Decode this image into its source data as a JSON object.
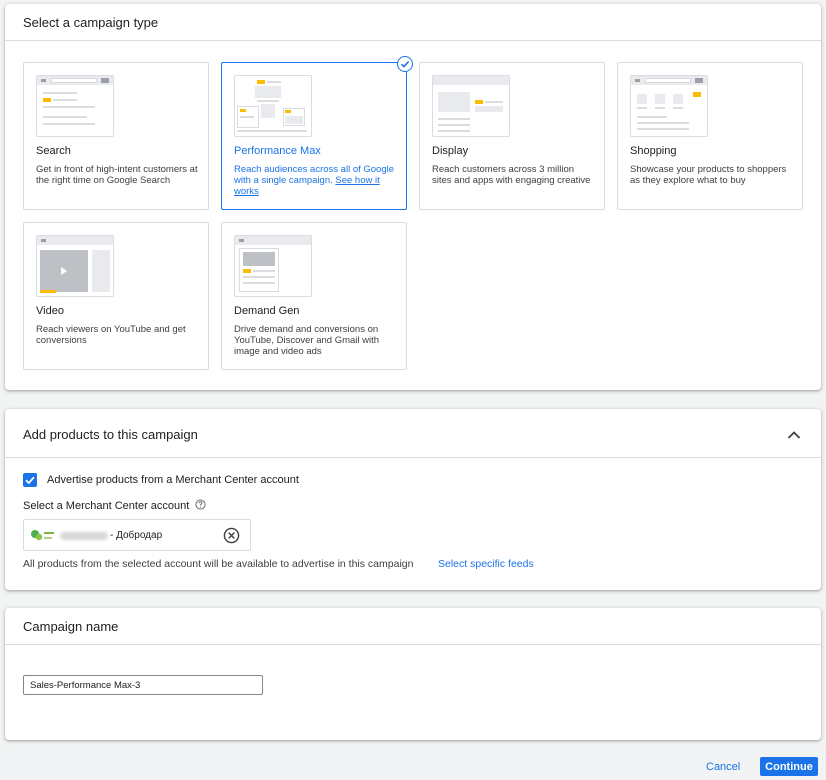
{
  "campaign_type": {
    "header": "Select a campaign type",
    "cards": [
      {
        "title": "Search",
        "description": "Get in front of high-intent customers at the right time on Google Search"
      },
      {
        "title": "Performance Max",
        "description": "Reach audiences across all of Google with a single campaign.",
        "link": "See how it works",
        "selected": true
      },
      {
        "title": "Display",
        "description": "Reach customers across 3 million sites and apps with engaging creative"
      },
      {
        "title": "Shopping",
        "description": "Showcase your products to shoppers as they explore what to buy"
      },
      {
        "title": "Video",
        "description": "Reach viewers on YouTube and get conversions"
      },
      {
        "title": "Demand Gen",
        "description": "Drive demand and conversions on YouTube, Discover and Gmail with image and video ads"
      }
    ]
  },
  "products": {
    "header": "Add products to this campaign",
    "checkbox_label": "Advertise products from a Merchant Center account",
    "checked": true,
    "select_label": "Select a Merchant Center account",
    "account_name": "- Добродар",
    "note": "All products from the selected account will be available to advertise in this campaign",
    "feeds_link": "Select specific feeds"
  },
  "campaign_name": {
    "header": "Campaign name",
    "value": "Sales-Performance Max-3"
  },
  "footer": {
    "cancel": "Cancel",
    "continue": "Continue"
  },
  "colors": {
    "accent": "#1a73e8",
    "yellow": "#fbbc04",
    "border": "#dadce0"
  }
}
